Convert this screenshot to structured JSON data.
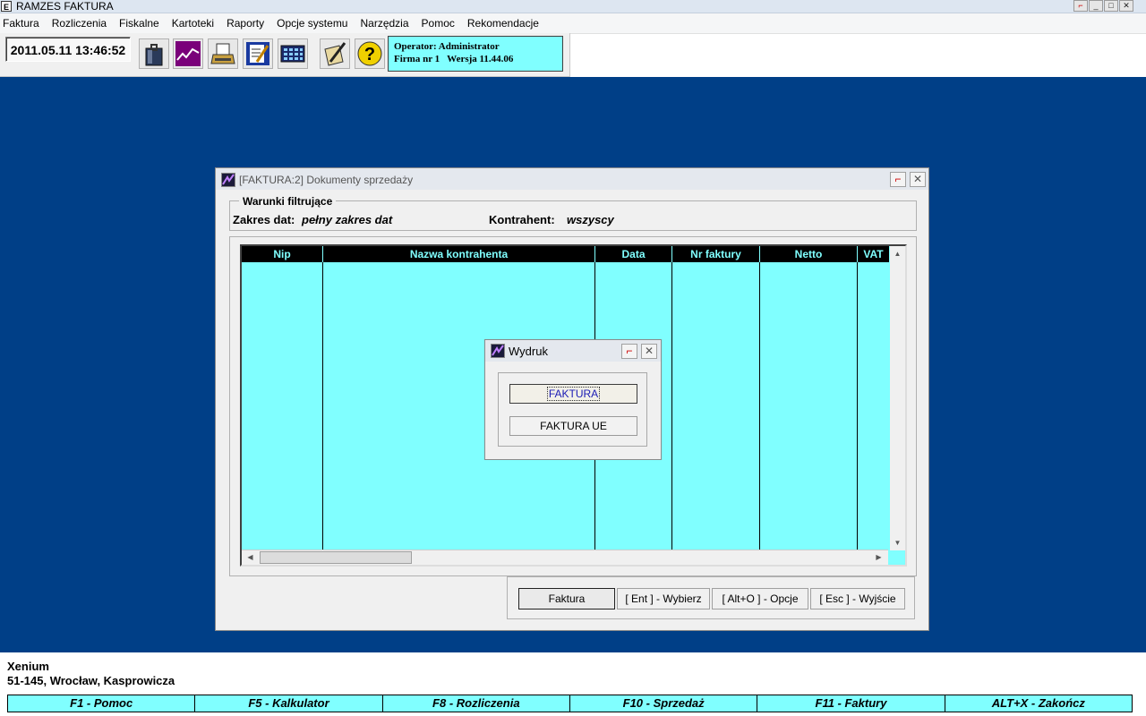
{
  "window": {
    "title": "RAMZES FAKTURA",
    "app_icon_letter": "E",
    "controls": [
      "⌐",
      "_",
      "□",
      "✕"
    ]
  },
  "menu": [
    "Faktura",
    "Rozliczenia",
    "Fiskalne",
    "Kartoteki",
    "Raporty",
    "Opcje systemu",
    "Narzędzia",
    "Pomoc",
    "Rekomendacje"
  ],
  "toolbar": {
    "datetime": "2011.05.11 13:46:52",
    "buttons": [
      "shopping-bag-icon",
      "chart-trend-icon",
      "printer-icon",
      "document-edit-icon",
      "calculator-icon",
      "notepad-pencil-icon",
      "help-icon"
    ],
    "operator_line": "Operator: Administrator",
    "firm_line": "Firma nr 1   Wersja 11.44.06"
  },
  "main_window": {
    "title": "[FAKTURA:2]  Dokumenty sprzedaży",
    "filters": {
      "legend": "Warunki filtrujące",
      "date_label": "Zakres dat:",
      "date_value": "pełny zakres dat",
      "contractor_label": "Kontrahent:",
      "contractor_value": "wszyscy"
    },
    "table": {
      "columns": [
        "Nip",
        "Nazwa kontrahenta",
        "Data",
        "Nr faktury",
        "Netto",
        "VAT"
      ],
      "rows": []
    },
    "buttons": {
      "faktura": "Faktura",
      "wybierz": "[ Ent ] - Wybierz",
      "opcje": "[ Alt+O ] - Opcje",
      "wyjscie": "[ Esc ] - Wyjście"
    }
  },
  "dialog": {
    "title": "Wydruk",
    "options": [
      "FAKTURA",
      "FAKTURA UE"
    ]
  },
  "company": {
    "name": "Xenium",
    "address": "51-145, Wrocław, Kasprowicza"
  },
  "function_keys": [
    "F1 - Pomoc",
    "F5 - Kalkulator",
    "F8 - Rozliczenia",
    "F10 - Sprzedaż",
    "F11 - Faktury",
    "ALT+X - Zakończ"
  ],
  "colors": {
    "desktop": "#003f87",
    "grid_background": "#80ffff",
    "grid_header": "#000000",
    "grid_header_text": "#80ffff"
  }
}
